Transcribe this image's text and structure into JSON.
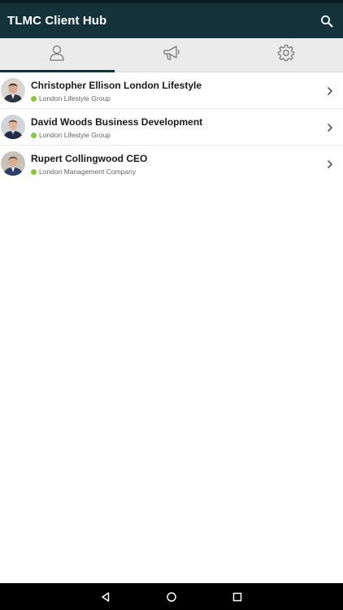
{
  "app": {
    "title": "TLMC Client Hub"
  },
  "header": {
    "search_icon": "search-icon"
  },
  "tabs": [
    {
      "icon": "person-icon",
      "active": true
    },
    {
      "icon": "megaphone-icon",
      "active": false
    },
    {
      "icon": "gear-icon",
      "active": false
    }
  ],
  "contacts": [
    {
      "name": "Christopher Ellison London Lifestyle",
      "company": "London Lifestyle Group",
      "status": "online"
    },
    {
      "name": "David Woods Business Development",
      "company": "London Lifestyle Group",
      "status": "online"
    },
    {
      "name": "Rupert Collingwood CEO",
      "company": "London Management Company",
      "status": "online"
    }
  ],
  "navbar": {
    "icons": [
      "back-icon",
      "home-icon",
      "recents-icon"
    ]
  },
  "colors": {
    "app_bar": "#13323a",
    "status_online": "#8dc63f",
    "tab_bar": "#ebebeb"
  }
}
